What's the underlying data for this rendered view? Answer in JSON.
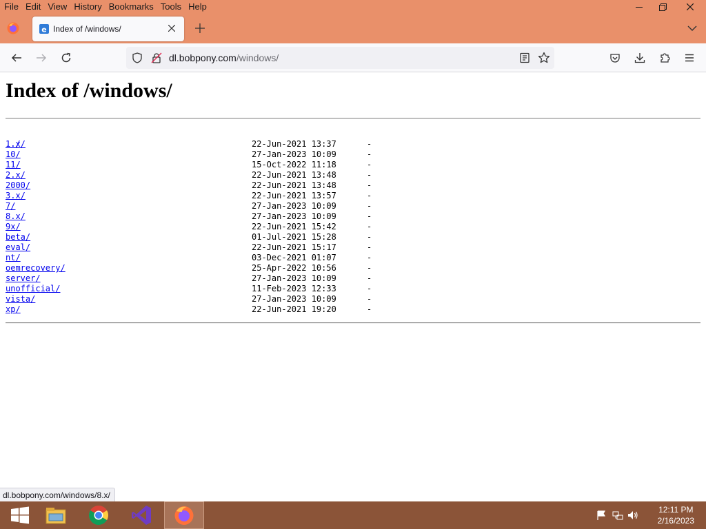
{
  "menu": {
    "items": [
      "File",
      "Edit",
      "View",
      "History",
      "Bookmarks",
      "Tools",
      "Help"
    ]
  },
  "tab": {
    "title": "Index of /windows/"
  },
  "urlbar": {
    "host": "dl.bobpony.com",
    "path": "/windows/"
  },
  "page": {
    "title": "Index of /windows/",
    "parent_link": "../",
    "entries": [
      {
        "name": "1.x/",
        "date": "22-Jun-2021 13:37",
        "size": "-"
      },
      {
        "name": "10/",
        "date": "27-Jan-2023 10:09",
        "size": "-"
      },
      {
        "name": "11/",
        "date": "15-Oct-2022 11:18",
        "size": "-"
      },
      {
        "name": "2.x/",
        "date": "22-Jun-2021 13:48",
        "size": "-"
      },
      {
        "name": "2000/",
        "date": "22-Jun-2021 13:48",
        "size": "-"
      },
      {
        "name": "3.x/",
        "date": "22-Jun-2021 13:57",
        "size": "-"
      },
      {
        "name": "7/",
        "date": "27-Jan-2023 10:09",
        "size": "-"
      },
      {
        "name": "8.x/",
        "date": "27-Jan-2023 10:09",
        "size": "-"
      },
      {
        "name": "9x/",
        "date": "22-Jun-2021 15:42",
        "size": "-"
      },
      {
        "name": "beta/",
        "date": "01-Jul-2021 15:28",
        "size": "-"
      },
      {
        "name": "eval/",
        "date": "22-Jun-2021 15:17",
        "size": "-"
      },
      {
        "name": "nt/",
        "date": "03-Dec-2021 01:07",
        "size": "-"
      },
      {
        "name": "oemrecovery/",
        "date": "25-Apr-2022 10:56",
        "size": "-"
      },
      {
        "name": "server/",
        "date": "27-Jan-2023 10:09",
        "size": "-"
      },
      {
        "name": "unofficial/",
        "date": "11-Feb-2023 12:33",
        "size": "-"
      },
      {
        "name": "vista/",
        "date": "27-Jan-2023 10:09",
        "size": "-"
      },
      {
        "name": "xp/",
        "date": "22-Jun-2021 19:20",
        "size": "-"
      }
    ]
  },
  "status_link": "dl.bobpony.com/windows/8.x/",
  "taskbar": {
    "apps": [
      "start-icon",
      "file-explorer-icon",
      "chrome-icon",
      "visual-studio-icon",
      "firefox-icon"
    ],
    "active_app": "firefox-icon"
  },
  "clock": {
    "time": "12:11 PM",
    "date": "2/16/2023"
  },
  "colors": {
    "titlebar": "#e9906a",
    "taskbar": "#8b5438",
    "link": "#0000ee"
  }
}
